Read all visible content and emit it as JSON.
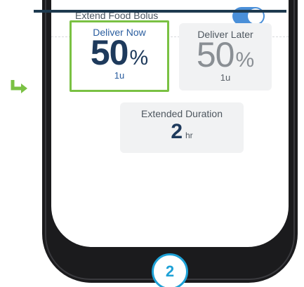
{
  "extend_food_bolus": {
    "label": "Extend Food Bolus",
    "toggle_on": true
  },
  "deliver_now": {
    "title": "Deliver Now",
    "percent": "50",
    "percent_unit": "%",
    "units": "1u",
    "selected": true
  },
  "deliver_later": {
    "title": "Deliver Later",
    "percent": "50",
    "percent_unit": "%",
    "units": "1u"
  },
  "extended_duration": {
    "title": "Extended Duration",
    "value": "2",
    "unit": "hr"
  },
  "step_badge": {
    "number": "2"
  },
  "colors": {
    "accent_blue": "#4a8fd8",
    "selection_green": "#7ac143",
    "badge_blue": "#1ea1d6",
    "value_navy": "#1e3a5c"
  },
  "icons": {
    "pointer_arrow": "return-arrow-icon"
  }
}
